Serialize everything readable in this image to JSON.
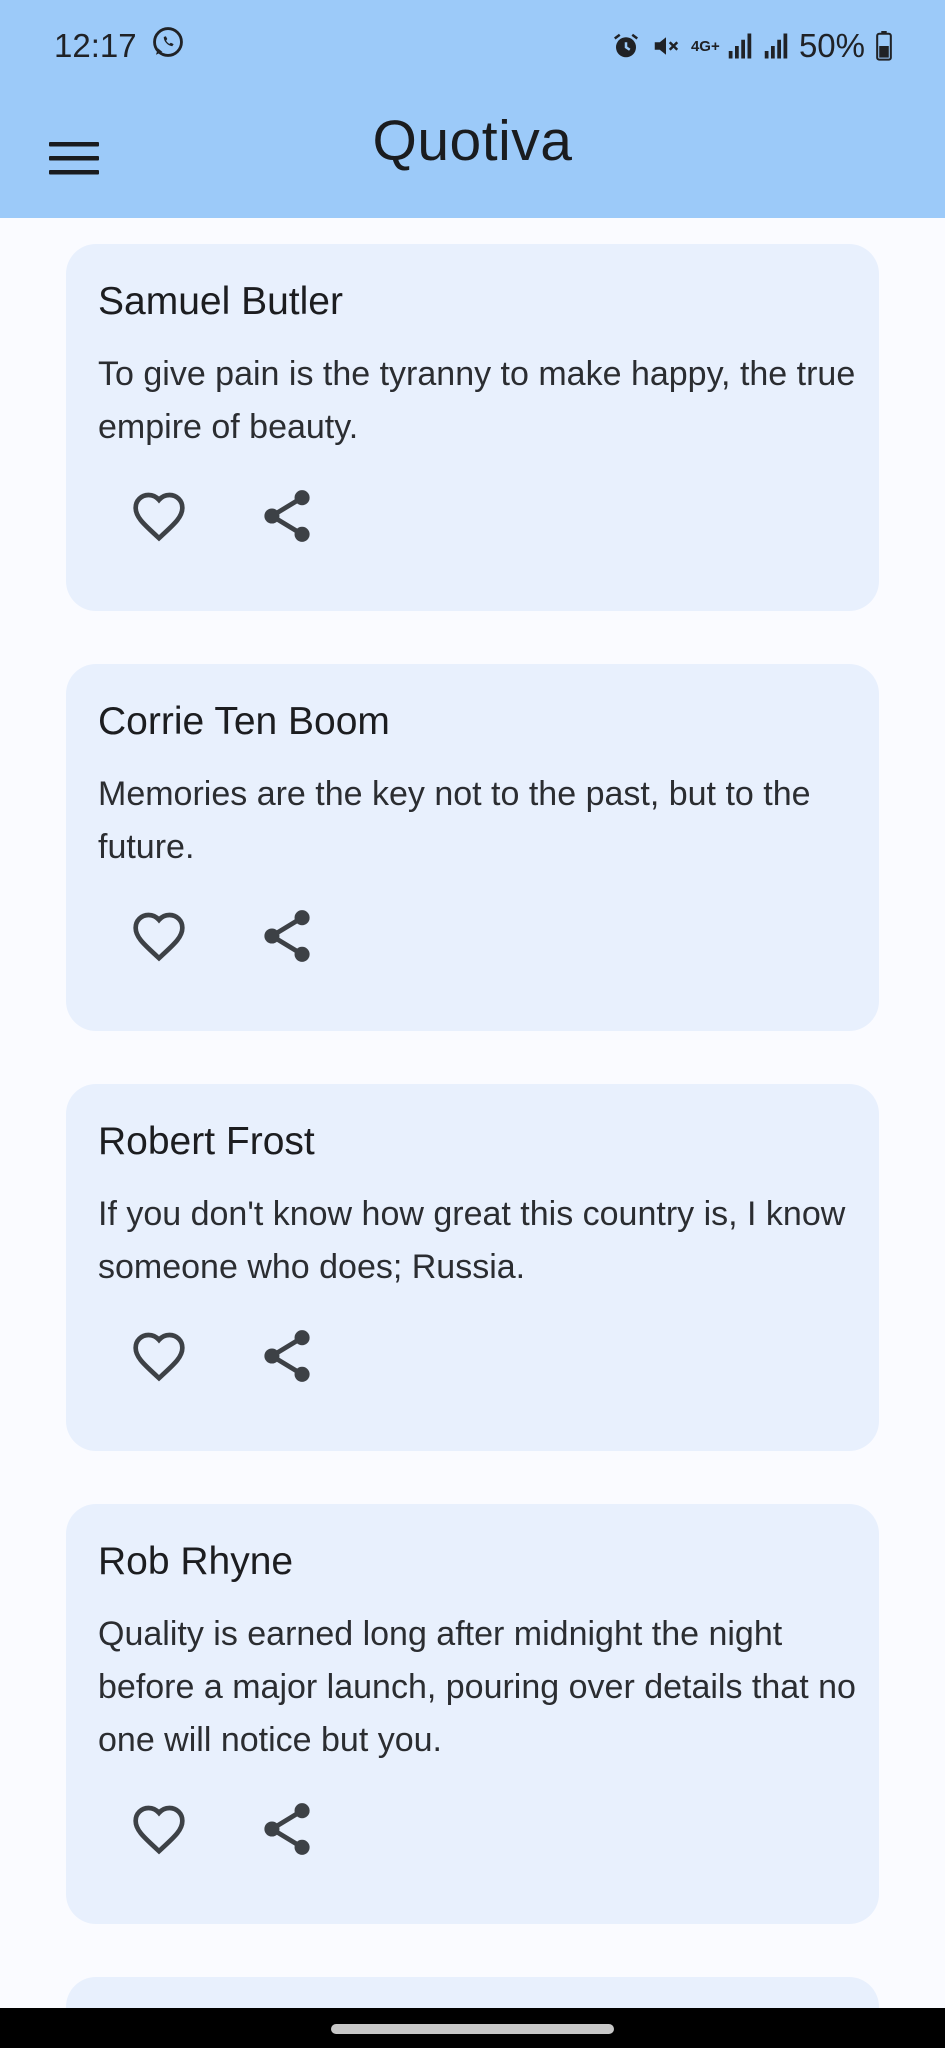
{
  "status_bar": {
    "time": "12:17",
    "network": "4G+",
    "battery": "50%",
    "icons": [
      "whatsapp-icon",
      "alarm-icon",
      "mute-icon",
      "signal-icon",
      "signal-icon",
      "battery-icon"
    ]
  },
  "app_bar": {
    "title": "Quotiva",
    "menu_icon": "menu-icon",
    "background_color": "#9ccaf9"
  },
  "quotes": [
    {
      "author": "Samuel Butler",
      "text": "To give pain is the tyranny to make happy, the true empire of beauty."
    },
    {
      "author": "Corrie Ten Boom",
      "text": "Memories are the key not to the past, but to the future."
    },
    {
      "author": "Robert Frost",
      "text": "If you don't know how great this country is, I know someone who does; Russia."
    },
    {
      "author": "Rob Rhyne",
      "text": "Quality is earned long after midnight the night before a major launch, pouring over details that no one will notice but you."
    }
  ],
  "card_actions": [
    "heart-icon",
    "share-icon"
  ],
  "card_color": "#e8f0fd"
}
